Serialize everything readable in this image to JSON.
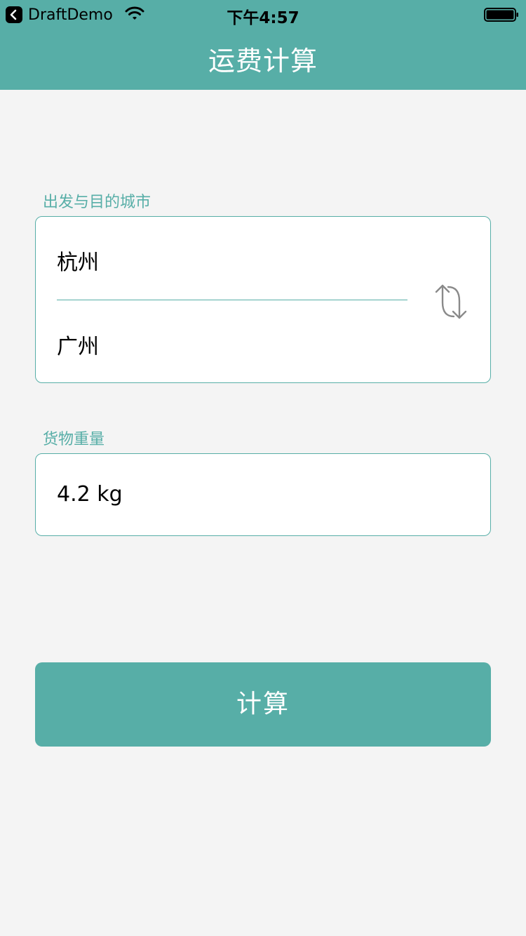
{
  "status_bar": {
    "back_app": "DraftDemo",
    "time": "下午4:57"
  },
  "nav": {
    "title": "运费计算"
  },
  "cities": {
    "label": "出发与目的城市",
    "origin": "杭州",
    "destination": "广州"
  },
  "weight": {
    "label": "货物重量",
    "value": "4.2 kg"
  },
  "actions": {
    "calculate": "计算"
  },
  "icons": {
    "back": "chevron-left-icon",
    "wifi": "wifi-icon",
    "battery": "battery-icon",
    "swap": "swap-arrows-icon"
  },
  "colors": {
    "accent": "#57aea7",
    "background": "#f4f4f4",
    "card": "#ffffff",
    "icon_gray": "#8a8a8a"
  }
}
